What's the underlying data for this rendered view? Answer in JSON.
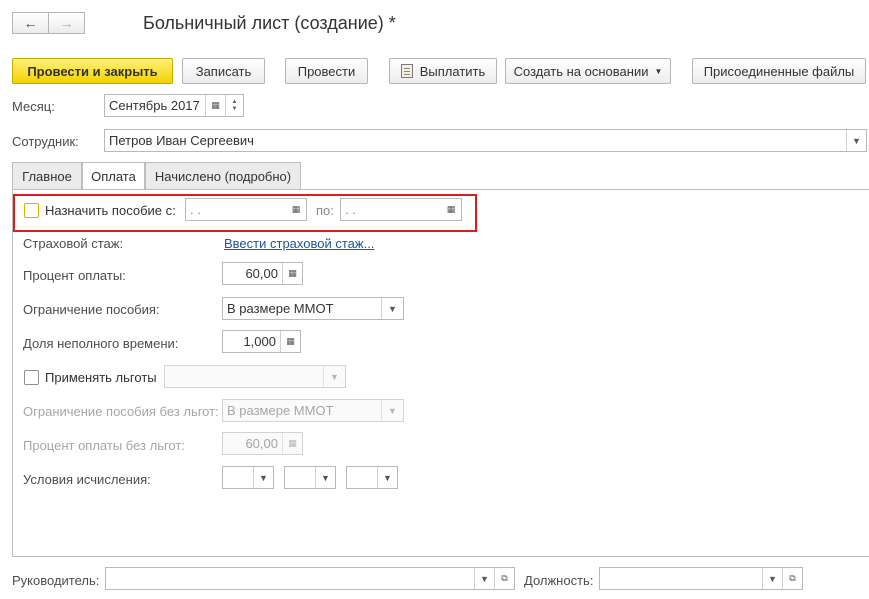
{
  "header": {
    "title": "Больничный лист (создание) *",
    "back_glyph": "🡐",
    "forward_glyph": "🡒"
  },
  "toolbar": {
    "post_close": "Провести и закрыть",
    "save": "Записать",
    "post": "Провести",
    "pay": "Выплатить",
    "create_based": "Создать на основании",
    "attached_files": "Присоединенные файлы"
  },
  "form": {
    "month_label": "Месяц:",
    "month_value": "Сентябрь 2017",
    "employee_label": "Сотрудник:",
    "employee_value": "Петров Иван Сергеевич"
  },
  "tabs": [
    {
      "label": "Главное"
    },
    {
      "label": "Оплата"
    },
    {
      "label": "Начислено (подробно)"
    }
  ],
  "payment": {
    "assign_benefit_label": "Назначить пособие с:",
    "date_from": " .  .",
    "to_label": "по:",
    "date_to": " .  .",
    "insurance_label": "Страховой стаж:",
    "insurance_link": "Ввести страховой стаж...",
    "percent_label": "Процент оплаты:",
    "percent_value": "60,00",
    "limit_label": "Ограничение пособия:",
    "limit_value": "В размере ММОТ",
    "parttime_label": "Доля неполного времени:",
    "parttime_value": "1,000",
    "benefits_label": "Применять льготы",
    "benefits_value": "",
    "limit_nobenefit_label": "Ограничение пособия без льгот:",
    "limit_nobenefit_value": "В размере ММОТ",
    "percent_nobenefit_label": "Процент оплаты без льгот:",
    "percent_nobenefit_value": "60,00",
    "conditions_label": "Условия исчисления:"
  },
  "footer": {
    "manager_label": "Руководитель:",
    "manager_value": "",
    "position_label": "Должность:",
    "position_value": ""
  },
  "colors": {
    "primary_button": "#f2d200",
    "highlight_frame": "#d42020",
    "link": "#1c55a3"
  }
}
